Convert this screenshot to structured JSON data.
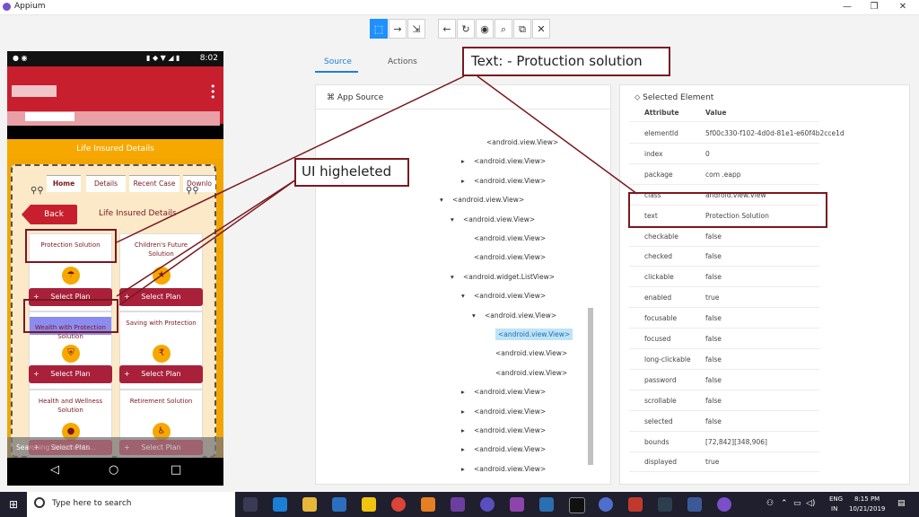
{
  "window": {
    "title": "Appium",
    "minimize": "—",
    "maximize": "❐",
    "close": "✕"
  },
  "toolbar": {
    "icons": [
      "select",
      "swipe",
      "tap-area",
      "back",
      "refresh",
      "show-hide",
      "search",
      "copy-xml",
      "quit"
    ],
    "glyphs": [
      "⬚",
      "→",
      "⇲",
      "←",
      "↻",
      "◉",
      "⌕",
      "⧉",
      "✕"
    ]
  },
  "phone": {
    "time": "8:02",
    "status_icons": "▮ ◆ ▼ ◢ ▮",
    "life_insured_bar": "Life Insured Details",
    "tabs": [
      "Home",
      "Details",
      "Recent Case",
      "Downlo"
    ],
    "back_label": "Back",
    "heading": "Life Insured Details",
    "plans": [
      {
        "title": "Protection Solution",
        "icon": "umbrella-icon",
        "glyph": "☂",
        "button": "Select Plan"
      },
      {
        "title": "Children's Future Solution",
        "icon": "star-icon",
        "glyph": "★",
        "button": "Select Plan"
      },
      {
        "title": "Wealth with Protection Solution",
        "icon": "shield-icon",
        "glyph": "⛨",
        "button": "Select Plan"
      },
      {
        "title": "Saving with Protection",
        "icon": "piggy-bank-icon",
        "glyph": "₹",
        "button": "Select Plan"
      },
      {
        "title": "Health and Wellness Solution",
        "icon": "apple-icon",
        "glyph": "●",
        "button": "Select Plan"
      },
      {
        "title": "Retirement Solution",
        "icon": "rocking-chair-icon",
        "glyph": "♿",
        "button": "Select Plan"
      }
    ],
    "plus": "+",
    "toast": "Searching documents...",
    "nav": [
      "◁",
      "○",
      "□"
    ]
  },
  "tabs": {
    "source": "Source",
    "actions": "Actions"
  },
  "app_source": {
    "heading": "App Source",
    "nodes": [
      {
        "label": "<android.view.View>",
        "arrow": ""
      },
      {
        "label": "<android.view.View>",
        "arrow": "▸"
      },
      {
        "label": "<android.view.View>",
        "arrow": "▸"
      },
      {
        "label": "<android.view.View>",
        "arrow": "▾"
      },
      {
        "label": "<android.view.View>",
        "arrow": "▾"
      },
      {
        "label": "<android.view.View>",
        "arrow": ""
      },
      {
        "label": "<android.view.View>",
        "arrow": ""
      },
      {
        "label": "<android.widget.ListView>",
        "arrow": "▾"
      },
      {
        "label": "<android.view.View>",
        "arrow": "▾"
      },
      {
        "label": "<android.view.View>",
        "arrow": "▾"
      },
      {
        "label": "<android.view.View>",
        "arrow": "",
        "selected": true
      },
      {
        "label": "<android.view.View>",
        "arrow": ""
      },
      {
        "label": "<android.view.View>",
        "arrow": ""
      },
      {
        "label": "<android.view.View>",
        "arrow": "▸"
      },
      {
        "label": "<android.view.View>",
        "arrow": "▸"
      },
      {
        "label": "<android.view.View>",
        "arrow": "▸"
      },
      {
        "label": "<android.view.View>",
        "arrow": "▸"
      },
      {
        "label": "<android.view.View>",
        "arrow": "▸"
      }
    ]
  },
  "selected_element": {
    "heading": "Selected Element",
    "col_attr": "Attribute",
    "col_value": "Value",
    "rows": [
      {
        "name": "elementId",
        "value": "5f00c330-f102-4d0d-81e1-e60f4b2cce1d"
      },
      {
        "name": "index",
        "value": "0"
      },
      {
        "name": "package",
        "value": "com       .eapp"
      },
      {
        "name": "class",
        "value": "android.view.View"
      },
      {
        "name": "text",
        "value": "Protection Solution"
      },
      {
        "name": "checkable",
        "value": "false"
      },
      {
        "name": "checked",
        "value": "false"
      },
      {
        "name": "clickable",
        "value": "false"
      },
      {
        "name": "enabled",
        "value": "true"
      },
      {
        "name": "focusable",
        "value": "false"
      },
      {
        "name": "focused",
        "value": "false"
      },
      {
        "name": "long-clickable",
        "value": "false"
      },
      {
        "name": "password",
        "value": "false"
      },
      {
        "name": "scrollable",
        "value": "false"
      },
      {
        "name": "selected",
        "value": "false"
      },
      {
        "name": "bounds",
        "value": "[72,842][348,906]"
      },
      {
        "name": "displayed",
        "value": "true"
      }
    ]
  },
  "annotations": {
    "text_callout": "Text: - Protuction solution",
    "ui_callout": "UI higheleted",
    "color": "#7a1820"
  },
  "taskbar": {
    "search_placeholder": "Type here to search",
    "lang": "ENG",
    "region": "IN",
    "time": "8:15 PM",
    "date": "10/21/2019",
    "start_glyph": "⊞"
  }
}
